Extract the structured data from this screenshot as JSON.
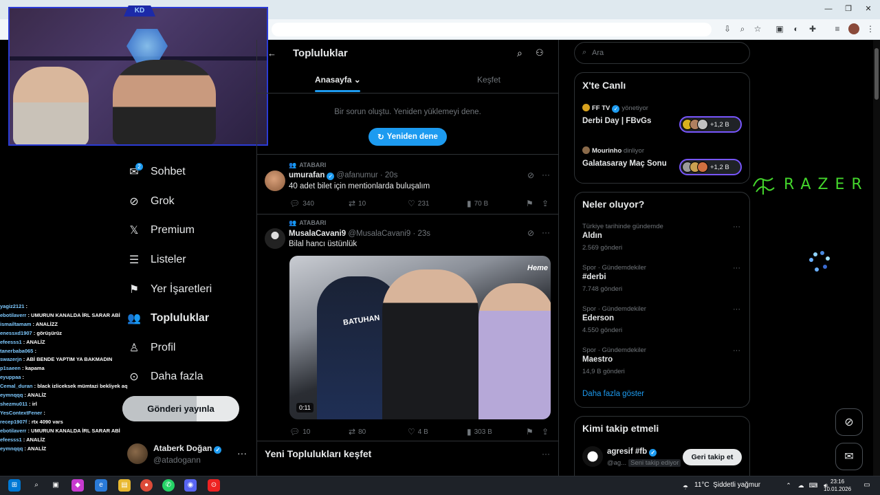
{
  "communities": {
    "title": "Topluluklar",
    "tabs": {
      "home": "Anasayfa",
      "explore": "Keşfet"
    },
    "error_text": "Bir sorun oluştu. Yeniden yüklemeyi dene.",
    "retry_label": "Yeniden dene",
    "discover_title": "Yeni Toplulukları keşfet"
  },
  "posts": [
    {
      "community": "ATABARI",
      "name": "umurafan",
      "handle": "@afanumur",
      "time": "20s",
      "text": "40 adet bilet için mentionlarda buluşalım",
      "replies": "340",
      "reposts": "10",
      "likes": "231",
      "views": "70 B"
    },
    {
      "community": "ATABARI",
      "name": "MusalaCavani9",
      "handle": "@MusalaCavani9",
      "time": "23s",
      "text": "Bilal hancı üstünlük",
      "video_duration": "0:11",
      "media_brand": "Heme",
      "media_jersey": "BATUHAN",
      "replies": "10",
      "reposts": "80",
      "likes": "4 B",
      "views": "303 B"
    }
  ],
  "nav": {
    "chat": "Sohbet",
    "chat_badge": "2",
    "grok": "Grok",
    "premium": "Premium",
    "lists": "Listeler",
    "bookmarks": "Yer İşaretleri",
    "communities": "Topluluklar",
    "profile": "Profil",
    "more": "Daha fazla",
    "post_button": "Gönderi yayınla"
  },
  "account": {
    "name": "Ataberk Doğan",
    "handle": "@atadogann"
  },
  "search": {
    "placeholder": "Ara"
  },
  "live": {
    "title": "X'te Canlı",
    "items": [
      {
        "host": "FF TV",
        "role": "yönetiyor",
        "title": "Derbi Day | FBvGs",
        "listeners": "+1,2 B"
      },
      {
        "host": "Mourinho",
        "role": "dinliyor",
        "title": "Galatasaray Maç Sonu",
        "listeners": "+1,2 B"
      }
    ]
  },
  "trends": {
    "title": "Neler oluyor?",
    "items": [
      {
        "category": "Türkiye tarihinde gündemde",
        "name": "Aldın",
        "count": "2.569 gönderi"
      },
      {
        "category": "Spor · Gündemdekiler",
        "name": "#derbi",
        "count": "7.748 gönderi"
      },
      {
        "category": "Spor · Gündemdekiler",
        "name": "Ederson",
        "count": "4.550 gönderi"
      },
      {
        "category": "Spor · Gündemdekiler",
        "name": "Maestro",
        "count": "14,9 B gönderi"
      }
    ],
    "show_more": "Daha fazla göster"
  },
  "who_to_follow": {
    "title": "Kimi takip etmeli",
    "name": "agresif #fb",
    "handle": "@ag...",
    "tag": "Seni takip ediyor",
    "button": "Geri takip et"
  },
  "stream_chat": [
    {
      "user": "yagiz2121",
      "msg": ""
    },
    {
      "user": "ebotilaverr",
      "msg": "UMURUN KANALDA İRL SARAR ABİ"
    },
    {
      "user": "ismailtamam",
      "msg": "ANALİZZ"
    },
    {
      "user": "enessxd1907",
      "msg": "görüşürüz"
    },
    {
      "user": "efeesss1",
      "msg": "ANALİZ"
    },
    {
      "user": "tanerbaba065",
      "msg": ""
    },
    {
      "user": "swazerjn",
      "msg": "ABİ BENDE YAPTIM YA BAKMADIN"
    },
    {
      "user": "p1saeen",
      "msg": "kapama"
    },
    {
      "user": "eyuppaa",
      "msg": ""
    },
    {
      "user": "Cemal_duran",
      "msg": "black izliceksek mümtazi bekliyek aq"
    },
    {
      "user": "eymnqqq",
      "msg": "ANALİZ"
    },
    {
      "user": "shezmu011",
      "msg": "irl"
    },
    {
      "user": "YesContextFener",
      "msg": ""
    },
    {
      "user": "recep1907f",
      "msg": "rtx 4090 vars"
    },
    {
      "user": "ebotilaverr",
      "msg": "UMURUN KANALDA İRL SARAR ABİ"
    },
    {
      "user": "efeesss1",
      "msg": "ANALİZ"
    },
    {
      "user": "eymnqqq",
      "msg": "ANALİZ"
    }
  ],
  "overlay": {
    "brand": "RAZER",
    "cam_badge": "KD"
  },
  "taskbar": {
    "temp": "11°C",
    "weather": "Şiddetli yağmur",
    "time": "23:16",
    "date": "10.01.2026"
  },
  "colors": {
    "accent": "#1d9bf0",
    "background": "#000000",
    "border": "#2f3336",
    "muted": "#71767b",
    "razer": "#44d62c"
  }
}
